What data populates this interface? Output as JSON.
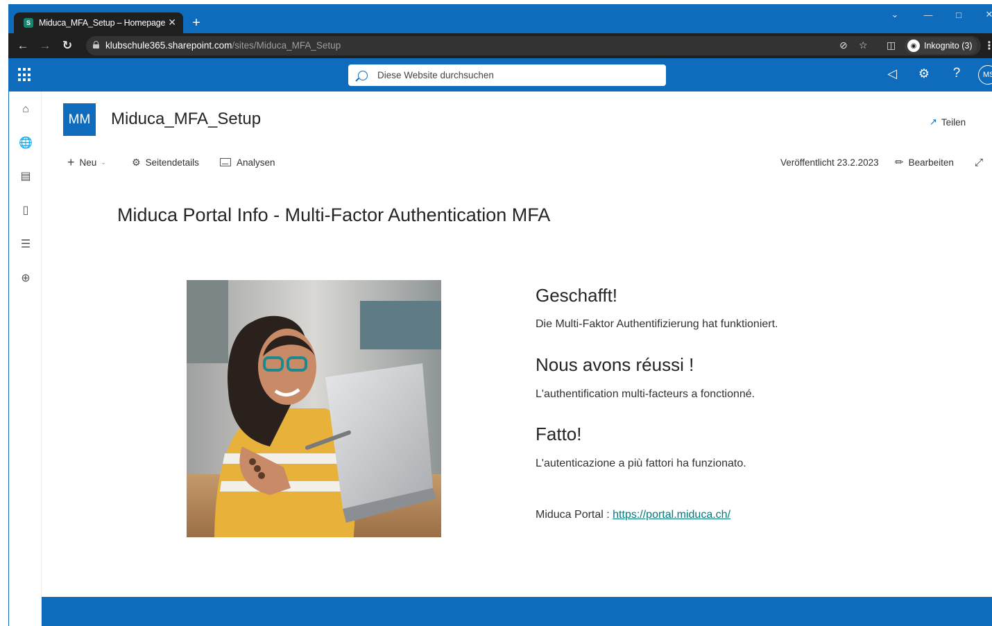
{
  "browser": {
    "tab_title": "Miduca_MFA_Setup – Homepage",
    "tab_close": "✕",
    "new_tab": "+",
    "url_host": "klubschule365.sharepoint.com",
    "url_path": "/sites/Miduca_MFA_Setup",
    "incognito_label": "Inkognito (3)",
    "window_buttons": [
      "chevron-down-icon",
      "minimize-icon",
      "maximize-icon",
      "close-icon"
    ]
  },
  "suitebar": {
    "search_placeholder": "Diese Website durchsuchen",
    "avatar_initials": "MS",
    "icons": [
      "app-launcher-icon",
      "megaphone-icon",
      "gear-icon",
      "help-icon"
    ]
  },
  "leftrail": {
    "icons": [
      "home-icon",
      "globe-icon",
      "news-icon",
      "file-icon",
      "list-icon",
      "add-circle-icon"
    ]
  },
  "site": {
    "logo_initials": "MM",
    "title": "Miduca_MFA_Setup",
    "share_label": "Teilen"
  },
  "commandbar": {
    "new_label": "Neu",
    "page_details_label": "Seitendetails",
    "analytics_label": "Analysen",
    "published_label": "Veröffentlicht 23.2.2023",
    "edit_label": "Bearbeiten"
  },
  "content": {
    "page_title": "Miduca Portal Info - Multi-Factor Authentication MFA",
    "sections": [
      {
        "heading": "Geschafft!",
        "text": "Die Multi-Faktor Authentifizierung hat funktioniert."
      },
      {
        "heading": "Nous avons réussi !",
        "text": "L'authentification multi-facteurs a fonctionné."
      },
      {
        "heading": "Fatto!",
        "text": "L'autenticazione a più fattori ha funzionato."
      }
    ],
    "portal_label": "Miduca Portal : ",
    "portal_link": "https://portal.miduca.ch/"
  },
  "colors": {
    "accent": "#0f6cbd",
    "chrome_dark": "#1f1f1f",
    "link": "#03787c",
    "text": "#252423"
  }
}
